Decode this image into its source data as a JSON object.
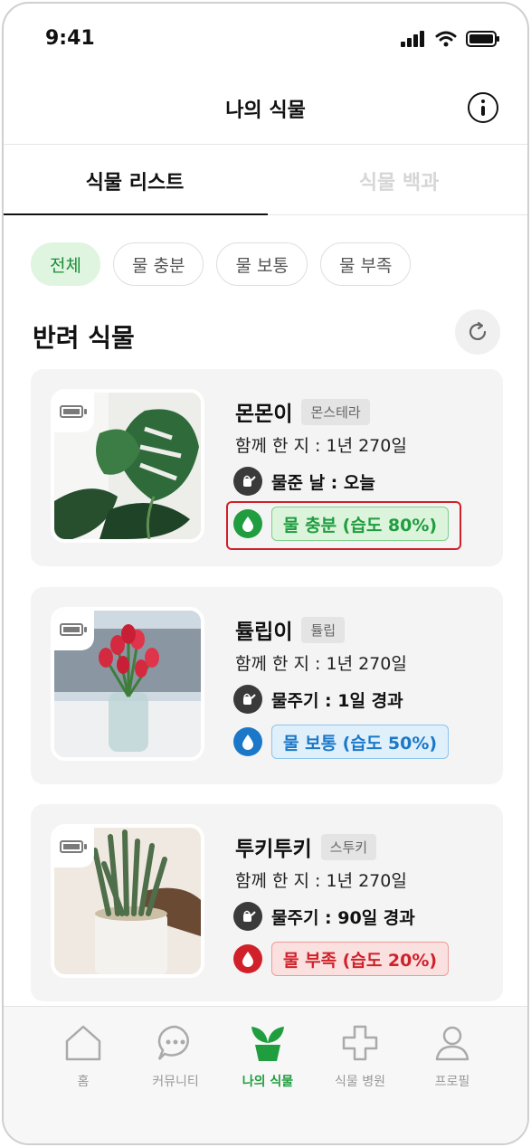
{
  "status_bar": {
    "time": "9:41"
  },
  "header": {
    "title": "나의 식물"
  },
  "tabs": [
    {
      "label": "식물 리스트",
      "active": true
    },
    {
      "label": "식물 백과",
      "active": false
    }
  ],
  "filters": [
    {
      "label": "전체",
      "selected": true
    },
    {
      "label": "물 충분",
      "selected": false
    },
    {
      "label": "물 보통",
      "selected": false
    },
    {
      "label": "물 부족",
      "selected": false
    }
  ],
  "section": {
    "title": "반려 식물"
  },
  "plants": [
    {
      "name": "몬몬이",
      "species": "몬스테라",
      "together": "함께 한 지 : 1년 270일",
      "water_info": "물준 날 : 오늘",
      "status": "물 충분 (습도 80%)",
      "status_color": "#1f9d3f",
      "image": "monstera"
    },
    {
      "name": "튤립이",
      "species": "튤립",
      "together": "함께 한 지 : 1년 270일",
      "water_info": "물주기 : 1일 경과",
      "status": "물 보통 (습도 50%)",
      "status_color": "#1b78c8",
      "image": "tulip"
    },
    {
      "name": "투키투키",
      "species": "스투키",
      "together": "함께 한 지 : 1년 270일",
      "water_info": "물주기 : 90일 경과",
      "status": "물 부족 (습도 20%)",
      "status_color": "#d0212a",
      "image": "stuckyi"
    }
  ],
  "bottom_nav": [
    {
      "label": "홈",
      "icon": "home-icon",
      "active": false
    },
    {
      "label": "커뮤니티",
      "icon": "chat-icon",
      "active": false
    },
    {
      "label": "나의 식물",
      "icon": "plant-icon",
      "active": true
    },
    {
      "label": "식물 병원",
      "icon": "plus-icon",
      "active": false
    },
    {
      "label": "프로필",
      "icon": "profile-icon",
      "active": false
    }
  ],
  "colors": {
    "accent_green": "#1f9d3f",
    "water_enough": "#1f9d3f",
    "water_normal": "#1b78c8",
    "water_low": "#d0212a"
  }
}
